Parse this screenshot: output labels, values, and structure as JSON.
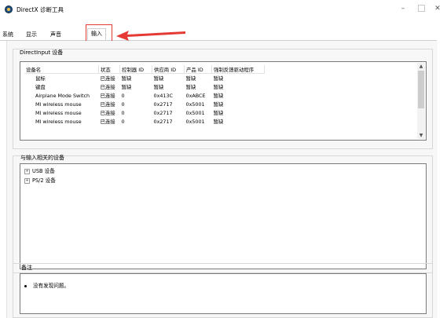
{
  "window": {
    "title": "DirectX 诊断工具",
    "minimize": "–",
    "close": "✕"
  },
  "tabs": [
    {
      "label": "系统"
    },
    {
      "label": "显示"
    },
    {
      "label": "声音"
    },
    {
      "label": "输入",
      "active": true
    }
  ],
  "directinput": {
    "group_label": "DirectInput 设备",
    "columns": [
      "设备名",
      "状态",
      "控制器 ID",
      "供应商 ID",
      "产品 ID",
      "强制反馈驱动程序"
    ],
    "rows": [
      [
        "鼠标",
        "已连接",
        "暂缺",
        "暂缺",
        "暂缺",
        "暂缺"
      ],
      [
        "键盘",
        "已连接",
        "暂缺",
        "暂缺",
        "暂缺",
        "暂缺"
      ],
      [
        "Airplane Mode Switch",
        "已连接",
        "0",
        "0x413C",
        "0xABCE",
        "暂缺"
      ],
      [
        "MI wireless mouse",
        "已连接",
        "0",
        "0x2717",
        "0x5001",
        "暂缺"
      ],
      [
        "MI wireless mouse",
        "已连接",
        "0",
        "0x2717",
        "0x5001",
        "暂缺"
      ],
      [
        "MI wireless mouse",
        "已连接",
        "0",
        "0x2717",
        "0x5001",
        "暂缺"
      ]
    ]
  },
  "related": {
    "group_label": "与输入相关的设备",
    "items": [
      {
        "expander": "+",
        "label": "USB 设备"
      },
      {
        "expander": "+",
        "label": "PS/2 设备"
      }
    ]
  },
  "notes": {
    "group_label": "备注",
    "items": [
      "没有发现问题。"
    ]
  },
  "colors": {
    "annotation": "#e53935"
  }
}
